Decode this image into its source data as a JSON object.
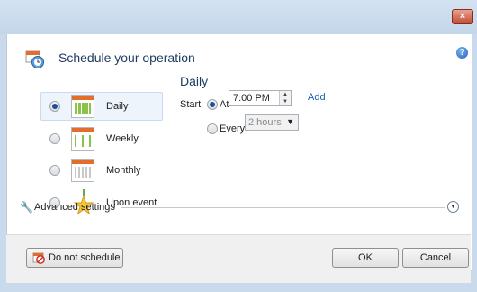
{
  "window": {
    "close_glyph": "×"
  },
  "header": {
    "title": "Schedule your operation",
    "icon": "calendar-clock-icon",
    "help_glyph": "?"
  },
  "options": [
    {
      "label": "Daily",
      "selected": true,
      "icon": "daily-calendar-icon"
    },
    {
      "label": "Weekly",
      "selected": false,
      "icon": "weekly-calendar-icon"
    },
    {
      "label": "Monthly",
      "selected": false,
      "icon": "monthly-calendar-icon"
    },
    {
      "label": "Upon event",
      "selected": false,
      "icon": "event-star-icon"
    }
  ],
  "daily": {
    "title": "Daily",
    "start_label": "Start",
    "at_label": "At",
    "at_selected": true,
    "time_value": "7:00 PM",
    "add_link": "Add",
    "every_label": "Every",
    "every_value": "2 hours"
  },
  "advanced": {
    "label": "Advanced settings"
  },
  "footer": {
    "do_not_schedule": "Do not schedule",
    "ok": "OK",
    "cancel": "Cancel"
  },
  "colors": {
    "accent": "#1a5fb4",
    "title": "#1e3a5f",
    "close": "#c44b35"
  }
}
